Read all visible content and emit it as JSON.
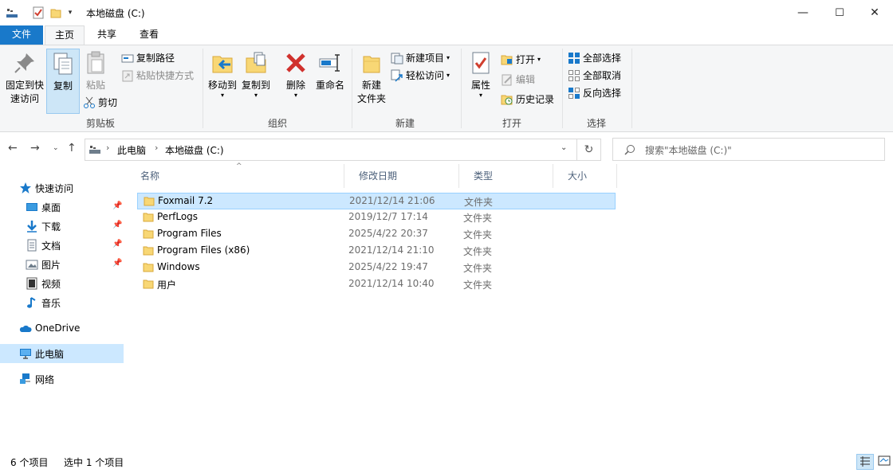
{
  "window": {
    "title": "本地磁盘 (C:)",
    "minimize_glyph": "—",
    "maximize_glyph": "☐",
    "close_glyph": "✕"
  },
  "ribbon_tabs": {
    "file": "文件",
    "home": "主页",
    "share": "共享",
    "view": "查看"
  },
  "ribbon": {
    "clipboard": {
      "label": "剪贴板",
      "pin": "固定到快速访问",
      "pin_line1": "固定到快",
      "pin_line2": "速访问",
      "copy": "复制",
      "paste": "粘贴",
      "copy_path": "复制路径",
      "paste_shortcut": "粘贴快捷方式",
      "cut": "剪切"
    },
    "organize": {
      "label": "组织",
      "move_to": "移动到",
      "copy_to": "复制到",
      "delete": "删除",
      "rename": "重命名"
    },
    "new": {
      "label": "新建",
      "new_folder_line1": "新建",
      "new_folder_line2": "文件夹",
      "new_item": "新建项目",
      "easy_access": "轻松访问"
    },
    "open": {
      "label": "打开",
      "properties": "属性",
      "open": "打开",
      "edit": "编辑",
      "history": "历史记录"
    },
    "select": {
      "label": "选择",
      "select_all": "全部选择",
      "select_none": "全部取消",
      "invert": "反向选择"
    }
  },
  "address": {
    "segments": [
      "此电脑",
      "本地磁盘 (C:)"
    ],
    "search_placeholder": "搜索\"本地磁盘 (C:)\""
  },
  "navpane": {
    "quick_access": "快速访问",
    "items": [
      {
        "label": "桌面",
        "pinned": true,
        "icon": "desktop-icon"
      },
      {
        "label": "下载",
        "pinned": true,
        "icon": "download-icon"
      },
      {
        "label": "文档",
        "pinned": true,
        "icon": "documents-icon"
      },
      {
        "label": "图片",
        "pinned": true,
        "icon": "pictures-icon"
      },
      {
        "label": "视频",
        "pinned": false,
        "icon": "videos-icon"
      },
      {
        "label": "音乐",
        "pinned": false,
        "icon": "music-icon"
      }
    ],
    "onedrive": "OneDrive",
    "this_pc": "此电脑",
    "network": "网络"
  },
  "filelist": {
    "columns": {
      "name": "名称",
      "date": "修改日期",
      "type": "类型",
      "size": "大小"
    },
    "rows": [
      {
        "name": "Foxmail 7.2",
        "date": "2021/12/14 21:06",
        "type": "文件夹",
        "selected": true
      },
      {
        "name": "PerfLogs",
        "date": "2019/12/7 17:14",
        "type": "文件夹",
        "selected": false
      },
      {
        "name": "Program Files",
        "date": "2025/4/22 20:37",
        "type": "文件夹",
        "selected": false
      },
      {
        "name": "Program Files (x86)",
        "date": "2021/12/14 21:10",
        "type": "文件夹",
        "selected": false
      },
      {
        "name": "Windows",
        "date": "2025/4/22 19:47",
        "type": "文件夹",
        "selected": false
      },
      {
        "name": "用户",
        "date": "2021/12/14 10:40",
        "type": "文件夹",
        "selected": false
      }
    ]
  },
  "status": {
    "count": "6 个项目",
    "selected": "选中 1 个项目"
  },
  "colors": {
    "accent": "#1979ca",
    "selection": "#cce8ff",
    "folder": "#f8d775"
  }
}
